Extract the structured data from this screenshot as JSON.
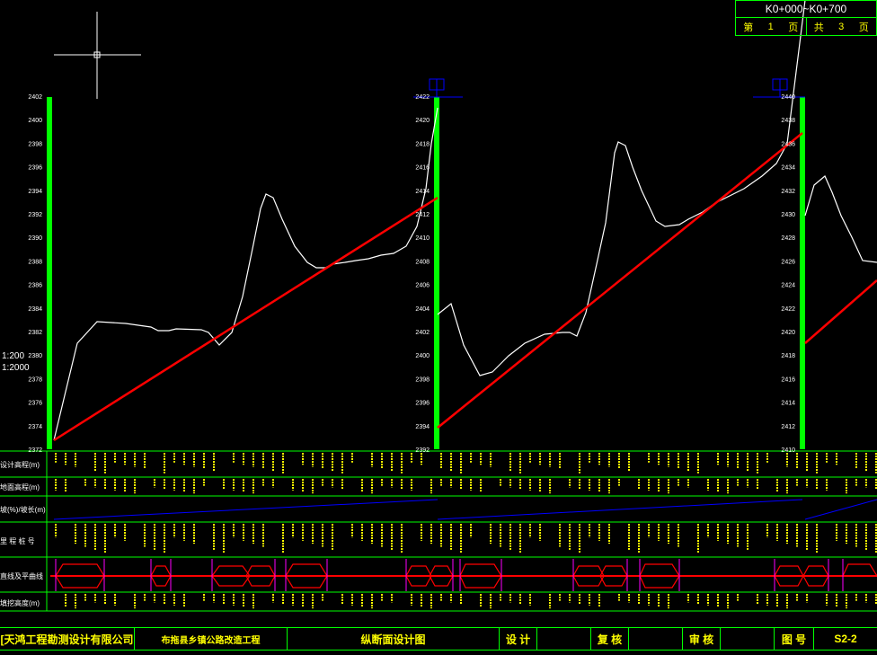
{
  "page_box": {
    "range": "K0+000~K0+700",
    "page_word": "第",
    "page_no": "1",
    "page_unit": "页",
    "total_word": "共",
    "total_no": "3",
    "total_unit": "页"
  },
  "scales": [
    "1:200",
    "1:2000"
  ],
  "row_labels": [
    "设计高程(m)",
    "地面高程(m)",
    "坡(%)/坡长(m)",
    "里 程 桩 号",
    "直线及平曲线",
    "填挖高度(m)"
  ],
  "title_bar": {
    "company": "[天鸿工程勘测设计有限公司",
    "project": "布拖县乡镇公路改造工程",
    "drawing": "纵断面设计图",
    "design": "设 计",
    "review": "复 核",
    "approve": "审 核",
    "drawing_no_label": "图 号",
    "drawing_no": "S2-2"
  },
  "panels": [
    {
      "name": "panel-1",
      "labels": [
        "2402",
        "2400",
        "2398",
        "2396",
        "2394",
        "2392",
        "2390",
        "2388",
        "2386",
        "2384",
        "2382",
        "2380",
        "2378",
        "2376",
        "2374",
        "2372"
      ]
    },
    {
      "name": "panel-2",
      "labels": [
        "2422",
        "2420",
        "2418",
        "2416",
        "2414",
        "2412",
        "2410",
        "2408",
        "2406",
        "2404",
        "2402",
        "2400",
        "2398",
        "2396",
        "2394",
        "2392"
      ]
    },
    {
      "name": "panel-3",
      "labels": [
        "2440",
        "2438",
        "2436",
        "2434",
        "2432",
        "2430",
        "2428",
        "2426",
        "2424",
        "2422",
        "2420",
        "2418",
        "2416",
        "2414",
        "2412",
        "2410"
      ]
    }
  ],
  "colors": {
    "grid": "#00ff00",
    "profile": "#ff0000",
    "ground": "#ffffff",
    "text": "#ffff00",
    "blue": "#0000ff",
    "magenta": "#ff00ff"
  }
}
